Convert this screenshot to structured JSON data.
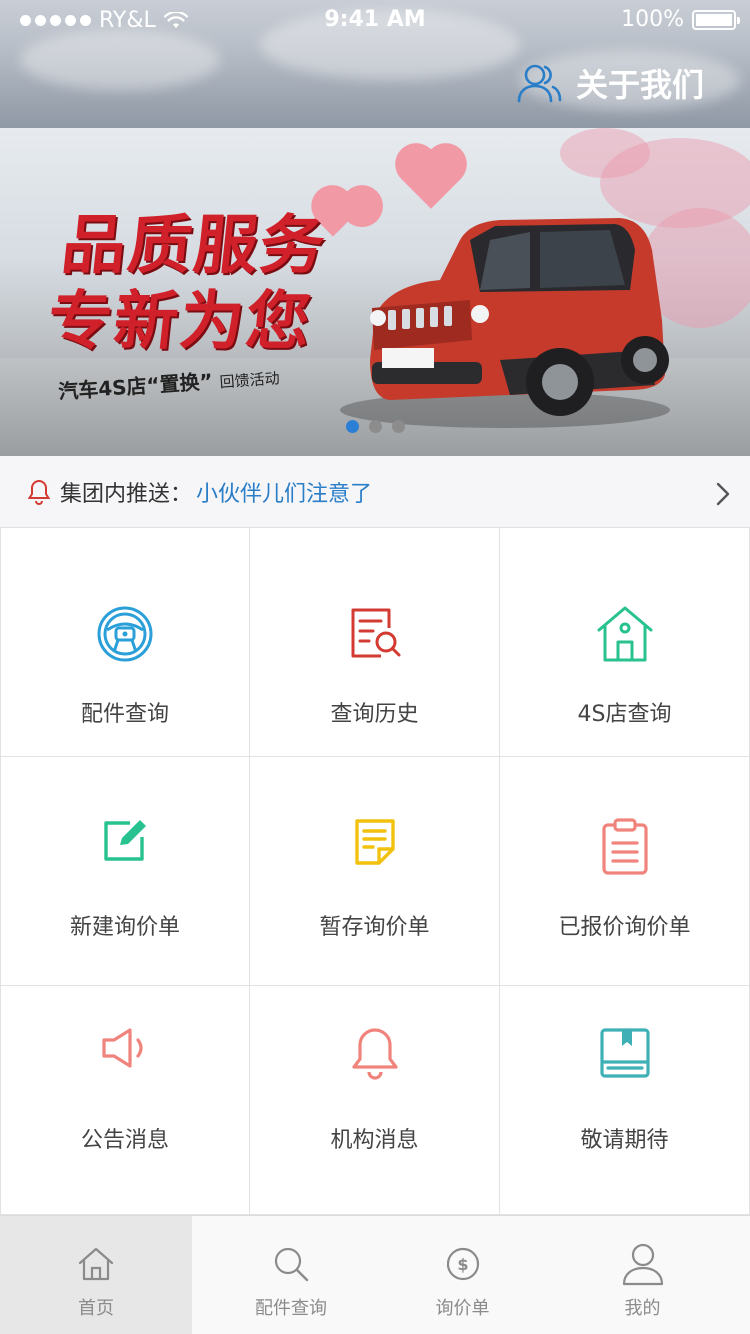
{
  "status_bar": {
    "carrier": "RY&L",
    "time": "9:41 AM",
    "battery": "100%"
  },
  "header": {
    "about_label": "关于我们"
  },
  "banner": {
    "headline_1": "品质服务",
    "headline_2": "专新为您",
    "subline_main": "汽车4S店“置换”",
    "subline_small": "回馈活动",
    "slide_count": 3,
    "active_slide": 1
  },
  "notice": {
    "label": "集团内推送：",
    "message": "小伙伴儿们注意了"
  },
  "grid": {
    "items": [
      {
        "label": "配件查询",
        "icon": "steering-wheel-icon",
        "color": "#2a9fd8"
      },
      {
        "label": "查询历史",
        "icon": "search-document-icon",
        "color": "#d33a31"
      },
      {
        "label": "4S店查询",
        "icon": "house-icon",
        "color": "#27c28f"
      },
      {
        "label": "新建询价单",
        "icon": "edit-icon",
        "color": "#27c28f"
      },
      {
        "label": "暂存询价单",
        "icon": "note-icon",
        "color": "#f2c10d"
      },
      {
        "label": "已报价询价单",
        "icon": "clipboard-icon",
        "color": "#f0837c"
      },
      {
        "label": "公告消息",
        "icon": "megaphone-icon",
        "color": "#f0837c"
      },
      {
        "label": "机构消息",
        "icon": "bell-icon",
        "color": "#f0837c"
      },
      {
        "label": "敬请期待",
        "icon": "book-icon",
        "color": "#3fb0b6"
      }
    ]
  },
  "tabbar": {
    "tabs": [
      {
        "label": "首页",
        "icon": "home-icon",
        "active": true
      },
      {
        "label": "配件查询",
        "icon": "search-icon",
        "active": false
      },
      {
        "label": "询价单",
        "icon": "dollar-icon",
        "active": false
      },
      {
        "label": "我的",
        "icon": "user-icon",
        "active": false
      }
    ]
  },
  "colors": {
    "accent_blue": "#2a7dc7",
    "brand_red": "#d0202a",
    "tab_text": "#8b8b8b"
  }
}
